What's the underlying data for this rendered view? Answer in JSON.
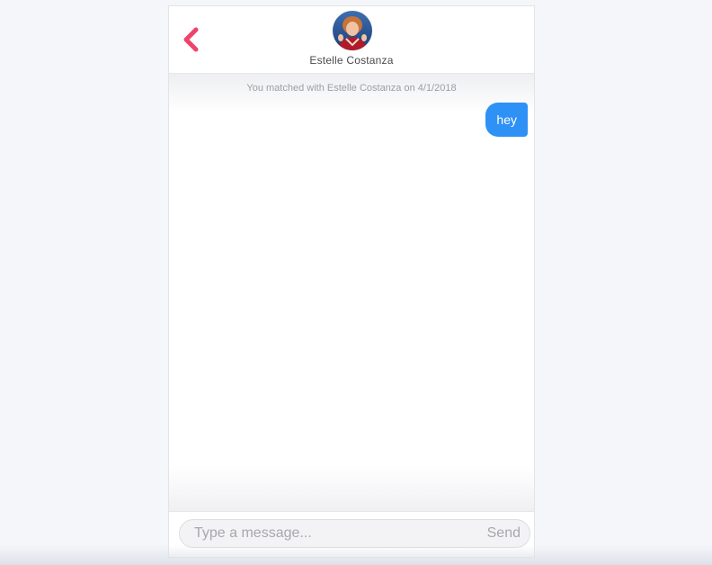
{
  "header": {
    "back_icon": "chevron-left-icon",
    "avatar_icon": "avatar",
    "contact_name": "Estelle Costanza"
  },
  "conversation": {
    "match_notice": "You matched with Estelle Costanza on 4/1/2018",
    "messages": [
      {
        "direction": "sent",
        "text": "hey"
      }
    ]
  },
  "composer": {
    "placeholder": "Type a message...",
    "value": "",
    "send_label": "Send"
  },
  "colors": {
    "accent": "#f0436a",
    "sent_bubble": "#2e91f5",
    "background": "#f4f6fa"
  }
}
